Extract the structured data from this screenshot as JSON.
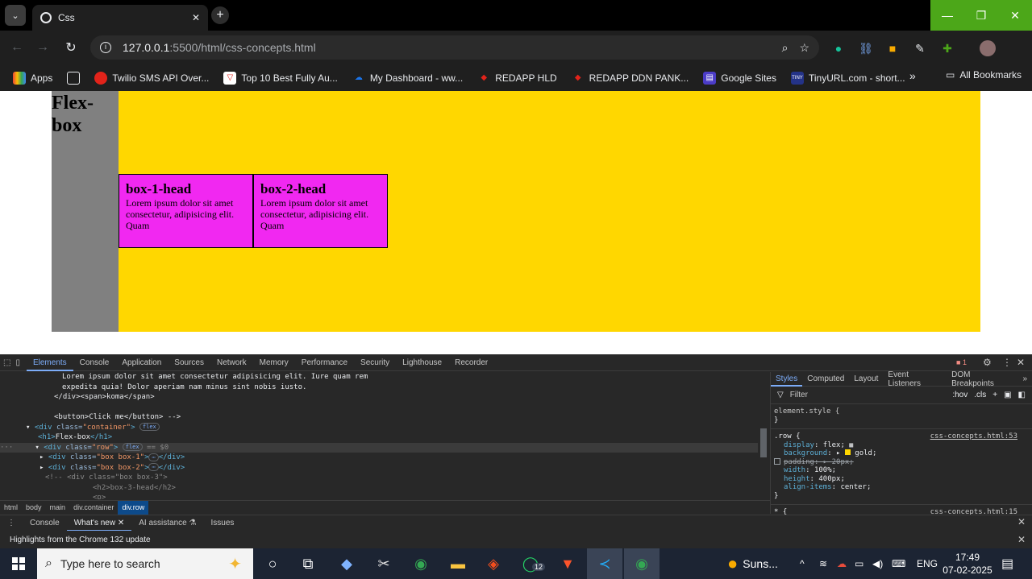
{
  "browser": {
    "tab_title": "Css",
    "url_host": "127.0.0.1",
    "url_path": ":5500/html/css-concepts.html"
  },
  "bookmarks": [
    {
      "label": "Apps",
      "color": "#ea4335"
    },
    {
      "label": "",
      "color": "#5f6368"
    },
    {
      "label": "Twilio SMS API Over...",
      "color": "#e2231a"
    },
    {
      "label": "Top 10 Best Fully Au...",
      "color": "#ffffff"
    },
    {
      "label": "My Dashboard - ww...",
      "color": "#1a73e8"
    },
    {
      "label": "REDAPP HLD",
      "color": "#e2231a"
    },
    {
      "label": "REDAPP DDN PANK...",
      "color": "#e2231a"
    },
    {
      "label": "Google Sites",
      "color": "#4b3cc7"
    },
    {
      "label": "TinyURL.com - short...",
      "color": "#243388"
    }
  ],
  "all_bookmarks": "All Bookmarks",
  "page": {
    "heading": "Flex-box",
    "boxes": [
      {
        "title": "box-1-head",
        "text": "Lorem ipsum dolor sit amet consectetur, adipisicing elit. Quam"
      },
      {
        "title": "box-2-head",
        "text": "Lorem ipsum dolor sit amet consectetur, adipisicing elit. Quam"
      }
    ]
  },
  "devtools": {
    "tabs": [
      "Elements",
      "Console",
      "Application",
      "Sources",
      "Network",
      "Memory",
      "Performance",
      "Security",
      "Lighthouse",
      "Recorder"
    ],
    "issues_count": "1",
    "styles_tabs": [
      "Styles",
      "Computed",
      "Layout",
      "Event Listeners",
      "DOM Breakpoints"
    ],
    "filter_placeholder": "Filter",
    "filter_hov": ":hov",
    "filter_cls": ".cls",
    "breadcrumbs": [
      "html",
      "body",
      "main",
      "div.container",
      "div.row"
    ],
    "drawer_tabs": [
      "Console",
      "What's new",
      "AI assistance",
      "Issues"
    ],
    "drawer_message": "Highlights from the Chrome 132 update",
    "elements_lines": {
      "l1": "Lorem ipsum dolor sit amet consectetur adipisicing elit. Iure quam rem",
      "l2": "expedita quia! Dolor aperiam nam minus sint nobis iusto.",
      "l3": "</div><span>koma</span>",
      "l4": "<button>Click me</button> -->",
      "container_class": "\"container\"",
      "h1_text": "Flex-box",
      "row_class": "\"row\"",
      "row_marker": "== $0",
      "box1_class": "\"box box-1\"",
      "box2_class": "\"box box-2\"",
      "comment_box3": "<!-- <div class=\"box box-3\">",
      "h2_line": "<h2>box-3-head</h2>",
      "p_line": "<p>",
      "flex_badge": "flex"
    },
    "styles": {
      "element_style": "element.style {",
      "close": "}",
      "row_selector": ".row {",
      "row_link": "css-concepts.html:53",
      "props": [
        {
          "name": "display",
          "value": "flex;"
        },
        {
          "name": "background",
          "value": "gold;"
        },
        {
          "name": "padding",
          "value": "20px;"
        },
        {
          "name": "width",
          "value": "100%;"
        },
        {
          "name": "height",
          "value": "400px;"
        },
        {
          "name": "align-items",
          "value": "center;"
        }
      ],
      "star_selector": "* {",
      "star_link": "css-concepts.html:15"
    }
  },
  "taskbar": {
    "search_placeholder": "Type here to search",
    "weather": "Suns...",
    "lang": "ENG",
    "time": "17:49",
    "date": "07-02-2025",
    "whatsapp_badge": "12"
  }
}
